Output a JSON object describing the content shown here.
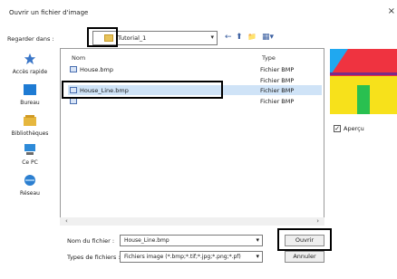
{
  "window": {
    "title": "Ouvrir un fichier d'image",
    "close_glyph": "×"
  },
  "lookin": {
    "label": "Regarder dans :",
    "value": "Tutorial_1",
    "arrow": "▾"
  },
  "toolbar": {
    "back": "←",
    "up": "⬆",
    "newfolder": "📁",
    "view": "▦▾"
  },
  "places": [
    {
      "label": "Accès rapide",
      "icon": "star-icon"
    },
    {
      "label": "Bureau",
      "icon": "desktop-icon"
    },
    {
      "label": "Bibliothèques",
      "icon": "libraries-icon"
    },
    {
      "label": "Ce PC",
      "icon": "pc-icon"
    },
    {
      "label": "Réseau",
      "icon": "network-icon"
    }
  ],
  "columns": {
    "name": "Nom",
    "type": "Type"
  },
  "files": [
    {
      "name": "House.bmp",
      "type": "Fichier BMP"
    },
    {
      "name": "",
      "type": "Fichier BMP"
    },
    {
      "name": "House_Line.bmp",
      "type": "Fichier BMP"
    },
    {
      "name": "",
      "type": "Fichier BMP"
    }
  ],
  "scroll": {
    "left": "‹",
    "right": "›"
  },
  "preview": {
    "label": "Aperçu",
    "checked": "✓"
  },
  "filename": {
    "label": "Nom du fichier :",
    "value": "House_Line.bmp"
  },
  "filetype": {
    "label": "Types de fichiers :",
    "value": "Fichiers image (*.bmp;*.tif;*.jpg;*.png;*.pf)"
  },
  "buttons": {
    "open": "Ouvrir",
    "cancel": "Annuler"
  }
}
